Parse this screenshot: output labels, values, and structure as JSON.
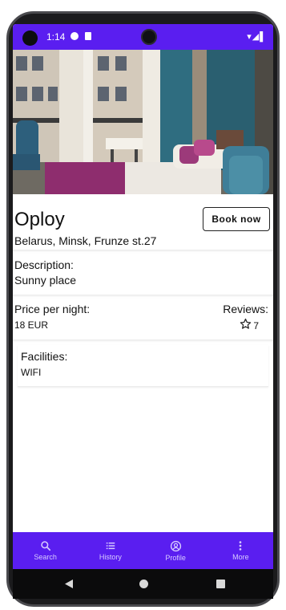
{
  "status_bar": {
    "time": "1:14",
    "right_icons": "▾◢▌"
  },
  "hotel": {
    "name": "Oploy",
    "address": "Belarus, Minsk, Frunze st.27",
    "book_button_label": "Book now"
  },
  "description": {
    "label": "Description:",
    "value": "Sunny place"
  },
  "price": {
    "label": "Price per night:",
    "value": "18 EUR"
  },
  "reviews": {
    "label": "Reviews:",
    "count": "7",
    "icon": "star-outline-icon"
  },
  "facilities": {
    "label": "Facilities:",
    "value": "WIFI"
  },
  "bottom_nav": {
    "items": [
      {
        "label": "Search",
        "icon": "search-icon"
      },
      {
        "label": "History",
        "icon": "list-icon"
      },
      {
        "label": "Profile",
        "icon": "profile-icon"
      },
      {
        "label": "More",
        "icon": "more-vertical-icon"
      }
    ]
  },
  "colors": {
    "accent": "#5a1ef0",
    "nav_text": "#d8ccff"
  }
}
